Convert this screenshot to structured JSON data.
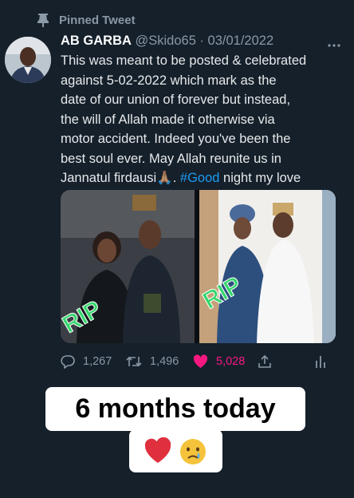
{
  "pinned_label": "Pinned Tweet",
  "tweet": {
    "author_name": "AB GARBA",
    "handle_date": "@Skido65 · 03/01/2022",
    "text_lines": [
      "This was meant to be posted & celebrated",
      "against 5-02-2022 which mark as the",
      "date  of our union of forever but instead,",
      "the will of Allah made it otherwise via",
      "motor accident. Indeed you've been the",
      "best soul ever. May Allah reunite us in"
    ],
    "last_line_start": "Jannatul firdausi",
    "last_line_emoji": "🙏🏽",
    "last_line_punct": ". ",
    "hashtag": "#Good",
    "last_line_end": " night my love"
  },
  "photo_overlay": {
    "left_text": "RIP",
    "right_text": "RIP"
  },
  "stats": {
    "replies": "1,267",
    "retweets": "1,496",
    "likes": "5,028"
  },
  "caption": "6 months today",
  "colors": {
    "background": "#15202b",
    "accent": "#1d9bf0",
    "like": "#f91880",
    "overlay_green": "#34d66b"
  },
  "icons": [
    "pin-icon",
    "more-icon",
    "reply-icon",
    "retweet-icon",
    "heart-icon",
    "share-icon",
    "analytics-icon",
    "broken-heart-icon",
    "crying-face-icon"
  ]
}
